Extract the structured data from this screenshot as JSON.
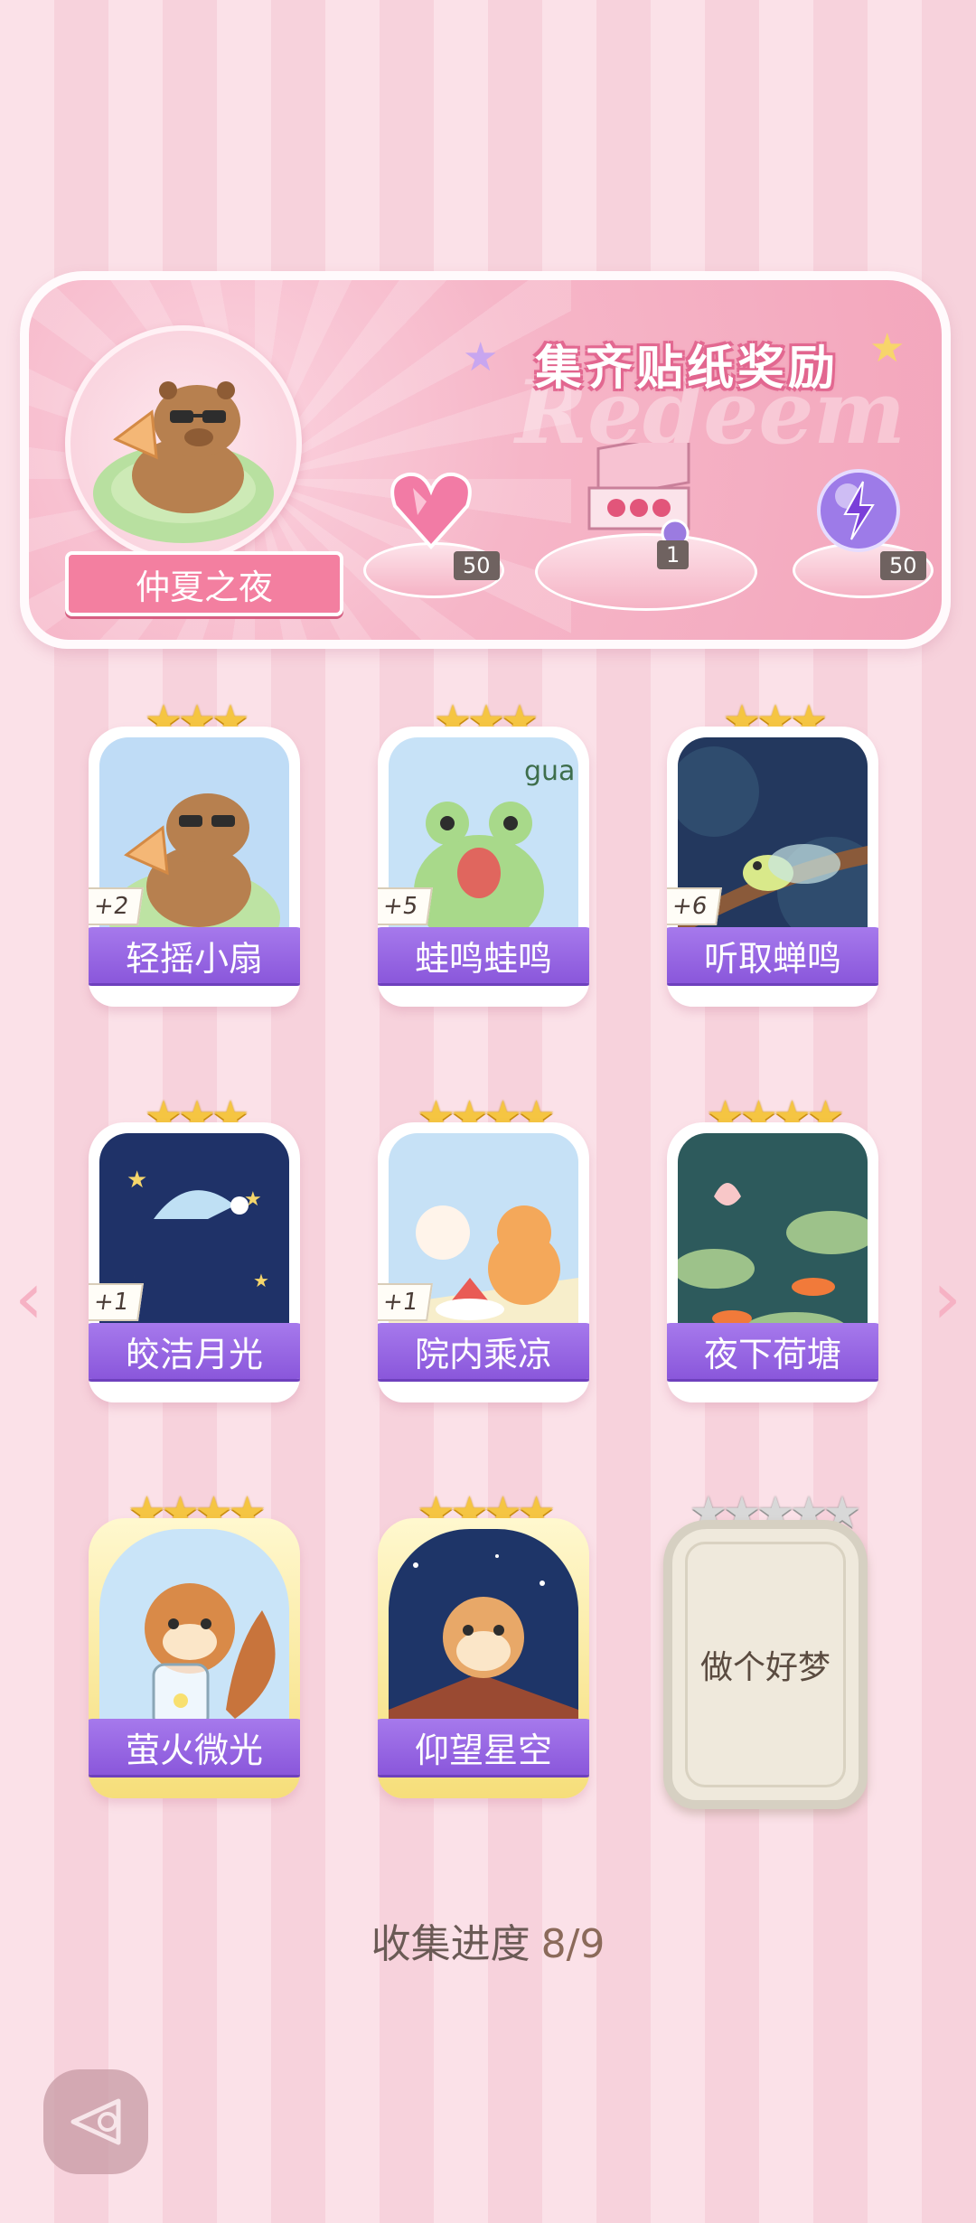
{
  "header": {
    "title": "集齐贴纸奖励",
    "ghost_text": "Redeem",
    "album_name": "仲夏之夜",
    "rewards": [
      {
        "icon": "pink-heart-gem-icon",
        "count": "50"
      },
      {
        "icon": "gift-box-icon",
        "count": "1"
      },
      {
        "icon": "lightning-orb-icon",
        "count": "50"
      }
    ]
  },
  "cards": [
    {
      "name": "轻摇小扇",
      "stars": "★★★",
      "bonus": "+2"
    },
    {
      "name": "蛙鸣蛙鸣",
      "stars": "★★★",
      "bonus": "+5",
      "art_text": "gua"
    },
    {
      "name": "听取蝉鸣",
      "stars": "★★★",
      "bonus": "+6"
    },
    {
      "name": "皎洁月光",
      "stars": "★★★",
      "bonus": "+1"
    },
    {
      "name": "院内乘凉",
      "stars": "★★★★",
      "bonus": "+1"
    },
    {
      "name": "夜下荷塘",
      "stars": "★★★★"
    },
    {
      "name": "萤火微光",
      "stars": "★★★★"
    },
    {
      "name": "仰望星空",
      "stars": "★★★★"
    },
    {
      "name": "做个好梦",
      "stars": "★★★★★"
    }
  ],
  "nav": {
    "left": "‹",
    "right": "›"
  },
  "progress": {
    "label": "收集进度",
    "value": "8/9"
  }
}
